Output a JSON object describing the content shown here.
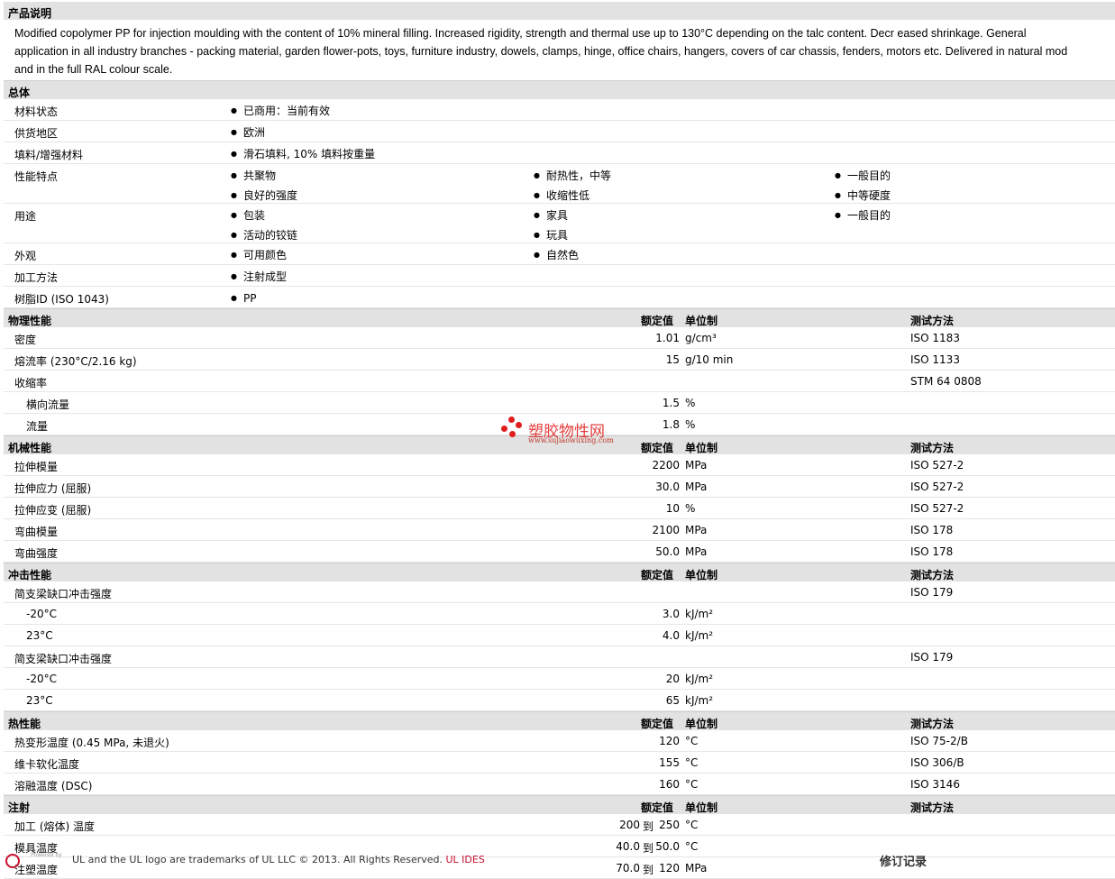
{
  "description": {
    "title": "产品说明",
    "lines": [
      "Modified copolymer PP for injection moulding with the content of 10% mineral filling. Increased rigidity, strength and thermal use up to 130°C depending on the talc content. Decr eased shrinkage. General",
      "application in all industry branches - packing material, garden flower-pots, toys, furniture industry, dowels, clamps, hinge, office chairs, hangers, covers of car chassis, fenders, motors etc. Delivered in natural mod",
      "and in the full RAL colour scale."
    ]
  },
  "general": {
    "title": "总体",
    "rows": [
      {
        "label": "材料状态",
        "col1": [
          "已商用：当前有效"
        ],
        "col2": [],
        "col3": []
      },
      {
        "label": "供货地区",
        "col1": [
          "欧洲"
        ],
        "col2": [],
        "col3": []
      },
      {
        "label": "填料/增强材料",
        "col1": [
          "滑石填料, 10% 填料按重量"
        ],
        "col2": [],
        "col3": []
      },
      {
        "label": "性能特点",
        "col1": [
          "共聚物",
          "良好的强度"
        ],
        "col2": [
          "耐热性，中等",
          "收缩性低"
        ],
        "col3": [
          "一般目的",
          "中等硬度"
        ]
      },
      {
        "label": "用途",
        "col1": [
          "包装",
          "活动的铰链"
        ],
        "col2": [
          "家具",
          "玩具"
        ],
        "col3": [
          "一般目的"
        ]
      },
      {
        "label": "外观",
        "col1": [
          "可用颜色"
        ],
        "col2": [
          "自然色"
        ],
        "col3": []
      },
      {
        "label": "加工方法",
        "col1": [
          "注射成型"
        ],
        "col2": [],
        "col3": []
      },
      {
        "label": "树脂ID (ISO 1043)",
        "col1": [
          "PP"
        ],
        "col2": [],
        "col3": []
      }
    ]
  },
  "col_headers": {
    "value": "额定值",
    "unit": "单位制",
    "method": "测试方法"
  },
  "physical": {
    "title": "物理性能",
    "rows": [
      {
        "label": "密度",
        "sub": false,
        "v1": "",
        "to": "",
        "value": "1.01",
        "unit": "g/cm³",
        "method": "ISO 1183"
      },
      {
        "label": "熔流率 (230°C/2.16 kg)",
        "sub": false,
        "v1": "",
        "to": "",
        "value": "15",
        "unit": "g/10 min",
        "method": "ISO 1133"
      },
      {
        "label": "收缩率",
        "sub": false,
        "v1": "",
        "to": "",
        "value": "",
        "unit": "",
        "method": "STM 64 0808"
      },
      {
        "label": "横向流量",
        "sub": true,
        "v1": "",
        "to": "",
        "value": "1.5",
        "unit": "%",
        "method": ""
      },
      {
        "label": "流量",
        "sub": true,
        "v1": "",
        "to": "",
        "value": "1.8",
        "unit": "%",
        "method": ""
      }
    ]
  },
  "mechanical": {
    "title": "机械性能",
    "rows": [
      {
        "label": "拉伸模量",
        "sub": false,
        "v1": "",
        "to": "",
        "value": "2200",
        "unit": "MPa",
        "method": "ISO 527-2"
      },
      {
        "label": "拉伸应力 (屈服)",
        "sub": false,
        "v1": "",
        "to": "",
        "value": "30.0",
        "unit": "MPa",
        "method": "ISO 527-2"
      },
      {
        "label": "拉伸应变 (屈服)",
        "sub": false,
        "v1": "",
        "to": "",
        "value": "10",
        "unit": "%",
        "method": "ISO 527-2"
      },
      {
        "label": "弯曲模量",
        "sub": false,
        "v1": "",
        "to": "",
        "value": "2100",
        "unit": "MPa",
        "method": "ISO 178"
      },
      {
        "label": "弯曲强度",
        "sub": false,
        "v1": "",
        "to": "",
        "value": "50.0",
        "unit": "MPa",
        "method": "ISO 178"
      }
    ]
  },
  "impact": {
    "title": "冲击性能",
    "rows": [
      {
        "label": "简支梁缺口冲击强度",
        "sub": false,
        "v1": "",
        "to": "",
        "value": "",
        "unit": "",
        "method": "ISO 179"
      },
      {
        "label": "-20°C",
        "sub": true,
        "v1": "",
        "to": "",
        "value": "3.0",
        "unit": "kJ/m²",
        "method": ""
      },
      {
        "label": "23°C",
        "sub": true,
        "v1": "",
        "to": "",
        "value": "4.0",
        "unit": "kJ/m²",
        "method": ""
      },
      {
        "label": "简支梁缺口冲击强度",
        "sub": false,
        "v1": "",
        "to": "",
        "value": "",
        "unit": "",
        "method": "ISO 179"
      },
      {
        "label": "-20°C",
        "sub": true,
        "v1": "",
        "to": "",
        "value": "20",
        "unit": "kJ/m²",
        "method": ""
      },
      {
        "label": "23°C",
        "sub": true,
        "v1": "",
        "to": "",
        "value": "65",
        "unit": "kJ/m²",
        "method": ""
      }
    ]
  },
  "thermal": {
    "title": "热性能",
    "rows": [
      {
        "label": "热变形温度 (0.45 MPa, 未退火)",
        "sub": false,
        "v1": "",
        "to": "",
        "value": "120",
        "unit": "°C",
        "method": "ISO 75-2/B"
      },
      {
        "label": "维卡软化温度",
        "sub": false,
        "v1": "",
        "to": "",
        "value": "155",
        "unit": "°C",
        "method": "ISO 306/B"
      },
      {
        "label": "溶融温度 (DSC)",
        "sub": false,
        "v1": "",
        "to": "",
        "value": "160",
        "unit": "°C",
        "method": "ISO 3146"
      }
    ]
  },
  "injection": {
    "title": "注射",
    "rows": [
      {
        "label": "加工 (熔体) 温度",
        "sub": false,
        "v1": "200",
        "to": "到",
        "value": "250",
        "unit": "°C",
        "method": ""
      },
      {
        "label": "模具温度",
        "sub": false,
        "v1": "40.0",
        "to": "到",
        "value": "50.0",
        "unit": "°C",
        "method": ""
      },
      {
        "label": "注塑温度",
        "sub": false,
        "v1": "70.0",
        "to": "到",
        "value": "120",
        "unit": "MPa",
        "method": ""
      }
    ]
  },
  "watermark": {
    "title": "塑胶物性网",
    "url": "www.sujiaowuxing.com",
    "color": "#e01d1d"
  },
  "footer": {
    "powered": "Powered by",
    "trademark": "UL and the UL logo are trademarks of UL LLC © 2013. All Rights Reserved.",
    "brand": "UL IDES",
    "revision": "修订记录"
  }
}
